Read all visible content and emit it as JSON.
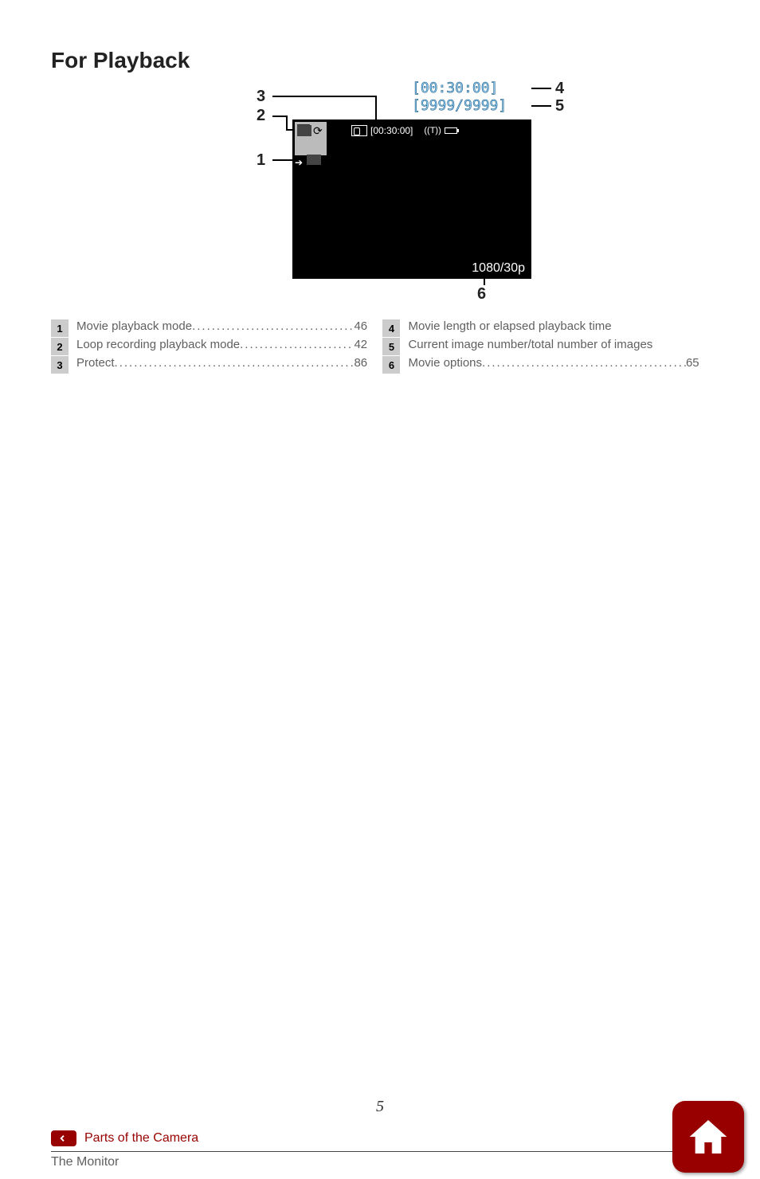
{
  "title": "For Playback",
  "diagram": {
    "elapsed": "[00:30:00]",
    "counter": "[9999/9999]",
    "timebar": "[00:30:00]",
    "resolution": "1080/30p",
    "labels": {
      "n1": "1",
      "n2": "2",
      "n3": "3",
      "n4": "4",
      "n5": "5",
      "n6": "6"
    }
  },
  "left": [
    {
      "n": "1",
      "t": "Movie playback mode",
      "p": "46"
    },
    {
      "n": "2",
      "t": "Loop recording playback mode",
      "p": "42"
    },
    {
      "n": "3",
      "t": "Protect",
      "p": "86"
    }
  ],
  "right": [
    {
      "n": "4",
      "t": "Movie length or elapsed playback time",
      "p": ""
    },
    {
      "n": "5",
      "t": "Current image number/total number of images",
      "p": ""
    },
    {
      "n": "6",
      "t": "Movie options",
      "p": "65"
    }
  ],
  "page_number": "5",
  "breadcrumb": "Parts of the Camera",
  "subtitle": "The Monitor"
}
